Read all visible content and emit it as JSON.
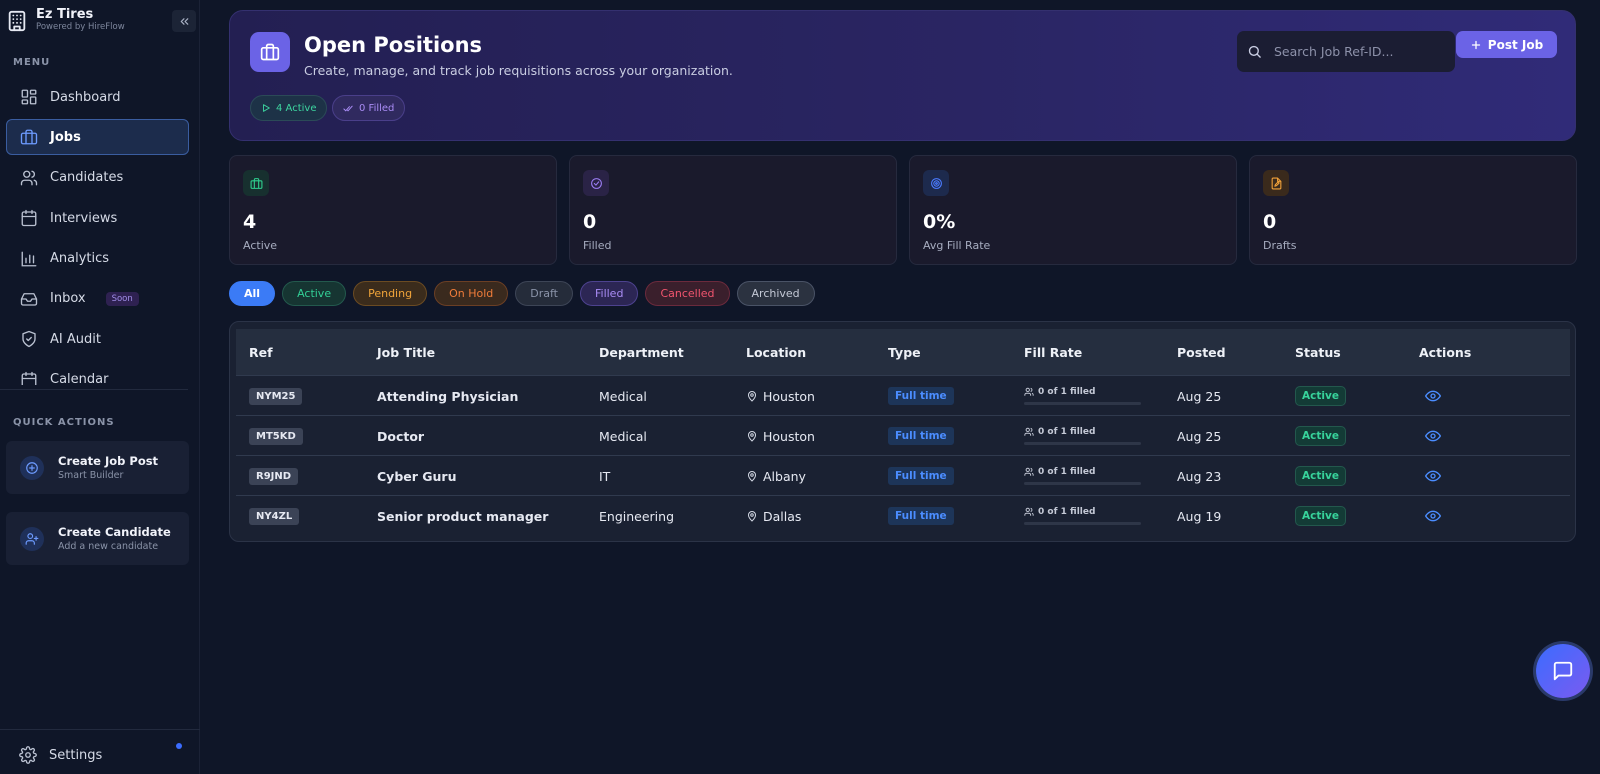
{
  "brand": {
    "name": "Ez Tires",
    "sub": "Powered by HireFlow"
  },
  "sidebar": {
    "menu_label": "MENU",
    "items": [
      {
        "label": "Dashboard",
        "icon": "grid-icon"
      },
      {
        "label": "Jobs",
        "icon": "briefcase-icon",
        "active": true
      },
      {
        "label": "Candidates",
        "icon": "users-icon"
      },
      {
        "label": "Interviews",
        "icon": "calendar-icon"
      },
      {
        "label": "Analytics",
        "icon": "bar-chart-icon"
      },
      {
        "label": "Inbox",
        "icon": "inbox-icon",
        "badge": "Soon"
      },
      {
        "label": "AI Audit",
        "icon": "shield-icon"
      },
      {
        "label": "Calendar",
        "icon": "calendar-icon"
      }
    ],
    "quick_actions_label": "QUICK ACTIONS",
    "quick_actions": [
      {
        "title": "Create Job Post",
        "sub": "Smart Builder",
        "icon": "plus-circle-icon"
      },
      {
        "title": "Create Candidate",
        "sub": "Add a new candidate",
        "icon": "user-plus-icon"
      }
    ],
    "settings_label": "Settings"
  },
  "header": {
    "title": "Open Positions",
    "subtitle": "Create, manage, and track job requisitions across your organization.",
    "active_pill": "4 Active",
    "filled_pill": "0 Filled",
    "search_placeholder": "Search Job Ref-ID...",
    "post_button": "Post Job"
  },
  "stats": [
    {
      "value": "4",
      "label": "Active",
      "color": "#2fcf8f"
    },
    {
      "value": "0",
      "label": "Filled",
      "color": "#9a7cf2"
    },
    {
      "value": "0%",
      "label": "Avg Fill Rate",
      "color": "#4b7bff"
    },
    {
      "value": "0",
      "label": "Drafts",
      "color": "#f2a23a"
    }
  ],
  "filters": [
    {
      "label": "All",
      "selected": true
    },
    {
      "label": "Active"
    },
    {
      "label": "Pending"
    },
    {
      "label": "On Hold"
    },
    {
      "label": "Draft"
    },
    {
      "label": "Filled"
    },
    {
      "label": "Cancelled"
    },
    {
      "label": "Archived"
    }
  ],
  "table": {
    "headers": [
      "Ref",
      "Job Title",
      "Department",
      "Location",
      "Type",
      "Fill Rate",
      "Posted",
      "Status",
      "Actions"
    ],
    "rows": [
      {
        "ref": "NYM25",
        "title": "Attending Physician",
        "department": "Medical",
        "location": "Houston",
        "type": "Full time",
        "fill_text": "0 of 1 filled",
        "fill_fraction": 0,
        "posted": "Aug 25",
        "status": "Active"
      },
      {
        "ref": "MT5KD",
        "title": "Doctor",
        "department": "Medical",
        "location": "Houston",
        "type": "Full time",
        "fill_text": "0 of 1 filled",
        "fill_fraction": 0,
        "posted": "Aug 25",
        "status": "Active"
      },
      {
        "ref": "R9JND",
        "title": "Cyber Guru",
        "department": "IT",
        "location": "Albany",
        "type": "Full time",
        "fill_text": "0 of 1 filled",
        "fill_fraction": 0,
        "posted": "Aug 23",
        "status": "Active"
      },
      {
        "ref": "NY4ZL",
        "title": "Senior product manager",
        "department": "Engineering",
        "location": "Dallas",
        "type": "Full time",
        "fill_text": "0 of 1 filled",
        "fill_fraction": 0,
        "posted": "Aug 19",
        "status": "Active"
      }
    ]
  }
}
